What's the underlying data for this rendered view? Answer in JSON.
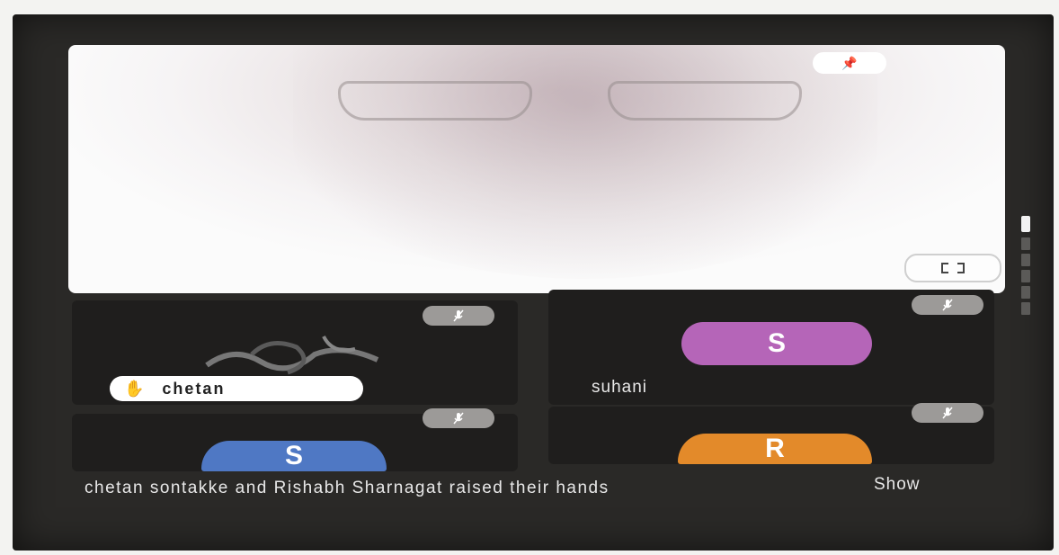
{
  "main_video": {
    "pin_icon": "pin-icon",
    "fullscreen_icon": "fullscreen-icon"
  },
  "tiles": [
    {
      "name": "chetan",
      "hand_icon": "raised-hand-icon",
      "mic_icon": "mic-off-icon"
    },
    {
      "name": "suhani",
      "avatar_letter": "S",
      "avatar_color": "#b565b8",
      "mic_icon": "mic-off-icon"
    },
    {
      "avatar_letter": "S",
      "avatar_color": "#4f78c4",
      "mic_icon": "mic-off-icon"
    },
    {
      "avatar_letter": "R",
      "avatar_color": "#e38a2a",
      "mic_icon": "mic-off-icon"
    }
  ],
  "notification": {
    "text": "chetan sontakke and Rishabh Sharnagat raised their hands",
    "action_label": "Show"
  },
  "colors": {
    "background": "#2a2927",
    "tile": "#1f1e1d",
    "mic_badge": "#9c9a98"
  }
}
